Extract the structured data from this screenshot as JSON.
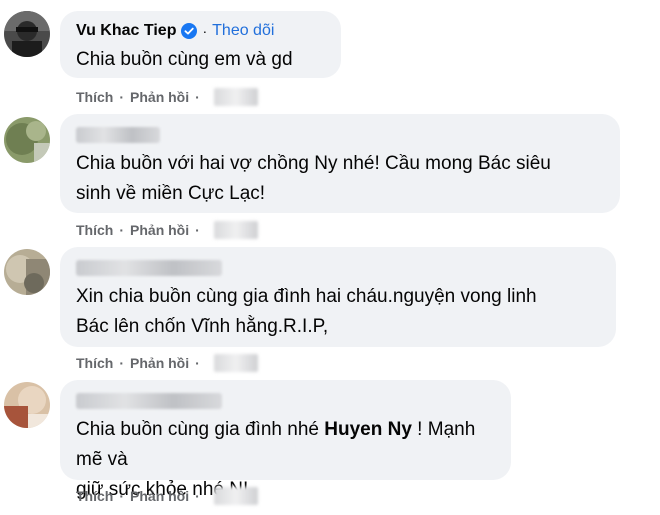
{
  "comments": [
    {
      "author": "Vu Khac Tiep",
      "verified": true,
      "follow_label": "Theo dõi",
      "text_parts": [
        "Chia buồn cùng em và gd"
      ],
      "like_label": "Thích",
      "reply_label": "Phản hồi"
    },
    {
      "author": "",
      "text_parts": [
        "Chia buồn với hai vợ chồng Ny nhé! Cầu mong Bác siêu",
        "sinh về miền Cực Lạc!"
      ],
      "like_label": "Thích",
      "reply_label": "Phản hồi"
    },
    {
      "author": "",
      "text_parts": [
        "Xin chia buồn cùng gia đình hai cháu.nguyện vong linh",
        "Bác lên chốn Vĩnh hằng.R.I.P,"
      ],
      "like_label": "Thích",
      "reply_label": "Phản hồi"
    },
    {
      "author": "",
      "text_line1_a": "Chia buồn cùng gia đình nhé ",
      "mention": "Huyen Ny",
      "text_line1_b": " ! Mạnh mẽ và",
      "text_line2": "giữ sức khỏe nhé N!",
      "like_label": "Thích",
      "reply_label": "Phản hồi"
    }
  ],
  "colors": {
    "bubble": "#f0f2f5",
    "text": "#050505",
    "meta": "#65676b",
    "link": "#216fdb",
    "verified": "#1877f2"
  },
  "icons": {
    "verified": "verified-badge-icon"
  }
}
